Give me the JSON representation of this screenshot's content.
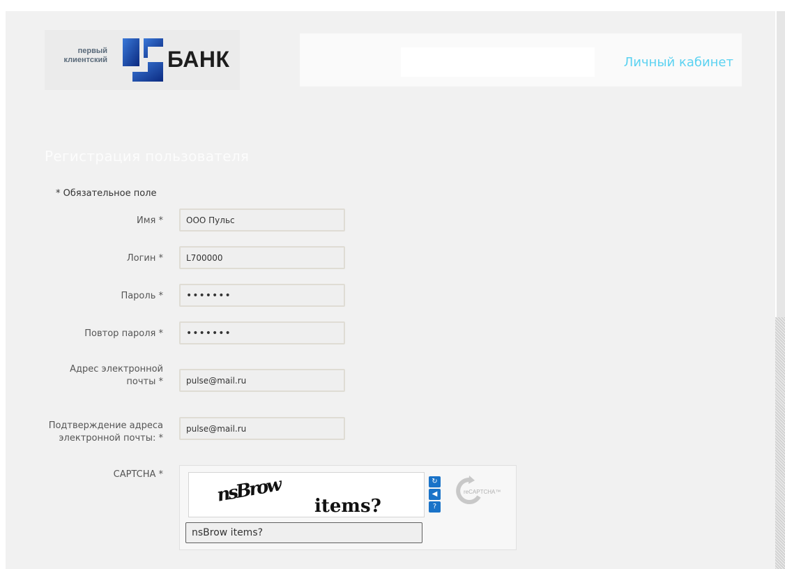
{
  "logo": {
    "small_line1": "первый",
    "small_line2": "клиентский",
    "word": "БАНК",
    "brand_color": "#1a3d9c"
  },
  "header": {
    "cabinet_link": "Личный кабинет",
    "link_color": "#5bd2f1"
  },
  "form": {
    "title": "Регистрация пользователя",
    "required_note": "* Обязательное поле",
    "fields": [
      {
        "label": "Имя *",
        "value": "ООО Пульс",
        "type": "text"
      },
      {
        "label": "Логин *",
        "value": "L700000",
        "type": "text"
      },
      {
        "label": "Пароль *",
        "value": "•••••••",
        "type": "password"
      },
      {
        "label": "Повтор пароля *",
        "value": "•••••••",
        "type": "password"
      },
      {
        "label_line1": "Адрес электронной",
        "label_line2": "почты *",
        "value": "pulse@mail.ru",
        "type": "email"
      },
      {
        "label_line1": "Подтверждение адреса",
        "label_line2": "электронной почты: *",
        "value": "pulse@mail.ru",
        "type": "email"
      }
    ],
    "captcha": {
      "label": "CAPTCHA *",
      "image_word1": "nsBrow",
      "image_word2": "items?",
      "input_value": "nsBrow items?",
      "controls": [
        "refresh-icon",
        "audio-icon",
        "help-icon"
      ],
      "provider_logo": "reCAPTCHA™"
    }
  }
}
